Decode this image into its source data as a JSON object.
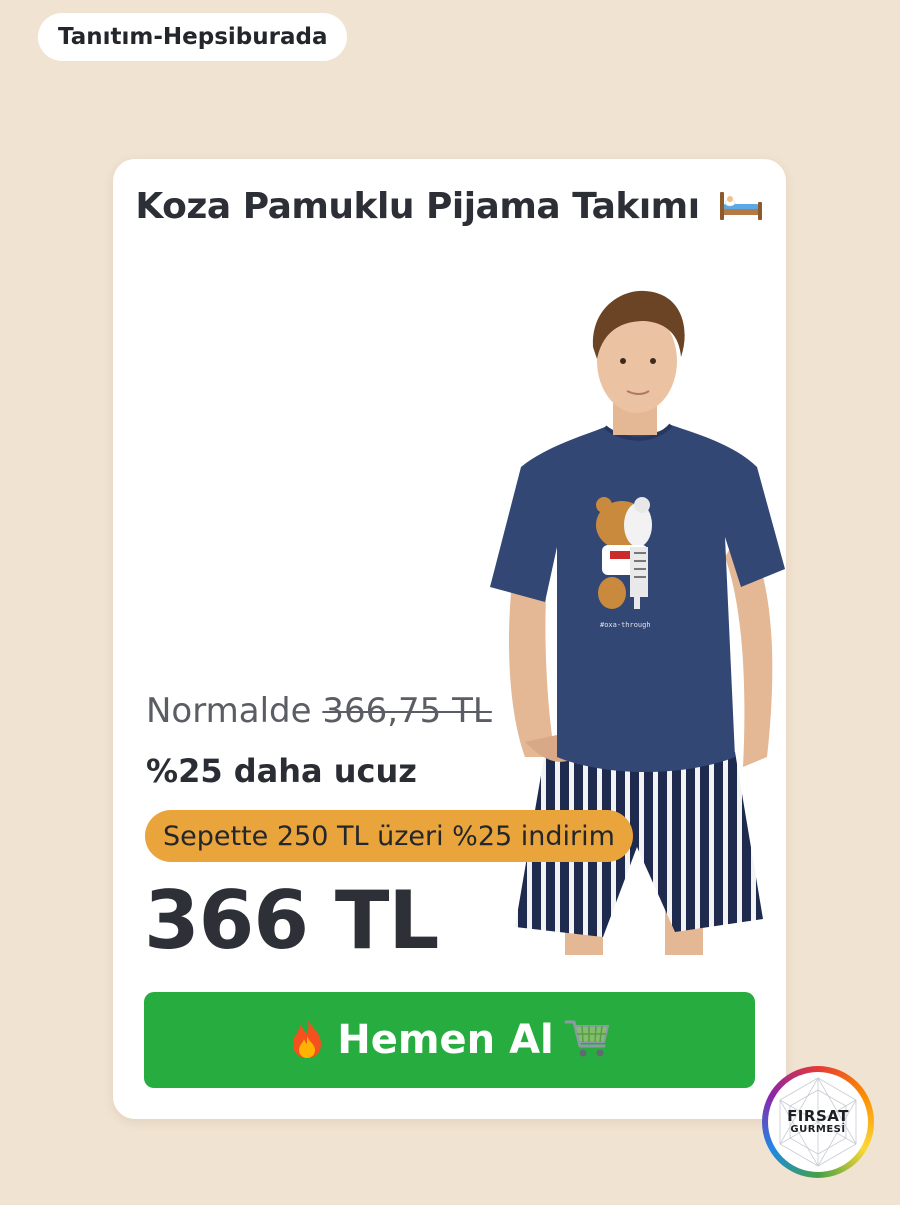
{
  "ad_tag": "Tanıtım-Hepsiburada",
  "product": {
    "title": "Koza Pamuklu Pijama Takımı",
    "title_icon": "bed-icon",
    "shirt_print_text": "#oxa-through"
  },
  "pricing": {
    "normal_prefix": "Normalde",
    "old_price": "366,75 TL",
    "discount_text": "%25 daha ucuz",
    "cart_promo": "Sepette 250 TL üzeri %25 indirim",
    "final_price": "366 TL"
  },
  "button": {
    "label": "Hemen Al",
    "left_icon": "fire-icon",
    "right_icon": "shopping-cart-icon"
  },
  "badge": {
    "line1": "FIRSAT",
    "line2": "GURMESİ"
  },
  "colors": {
    "background": "#f1e3d1",
    "card": "#ffffff",
    "promo_pill": "#eaa43c",
    "button": "#27ad3f",
    "text": "#2a2d33"
  }
}
